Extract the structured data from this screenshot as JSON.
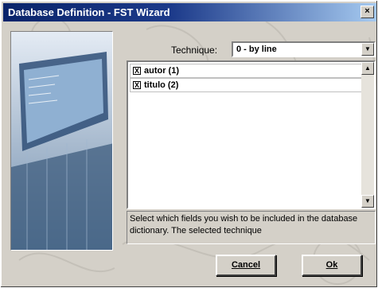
{
  "window": {
    "title": "Database Definition - FST Wizard",
    "close_glyph": "×"
  },
  "technique": {
    "label": "Technique:",
    "selected": "0 - by line",
    "arrow_glyph": "▼"
  },
  "fields": [
    {
      "label": "autor (1)",
      "checked": true,
      "check_glyph": "X"
    },
    {
      "label": "titulo (2)",
      "checked": true,
      "check_glyph": "X"
    }
  ],
  "scrollbar": {
    "up_glyph": "▲",
    "down_glyph": "▼"
  },
  "description": "Select which fields you wish to be included in the database dictionary. The selected technique",
  "buttons": {
    "cancel": "Cancel",
    "ok": "Ok"
  },
  "colors": {
    "title_start": "#0a246a",
    "title_end": "#a6caf0",
    "face": "#d4d0c8"
  }
}
